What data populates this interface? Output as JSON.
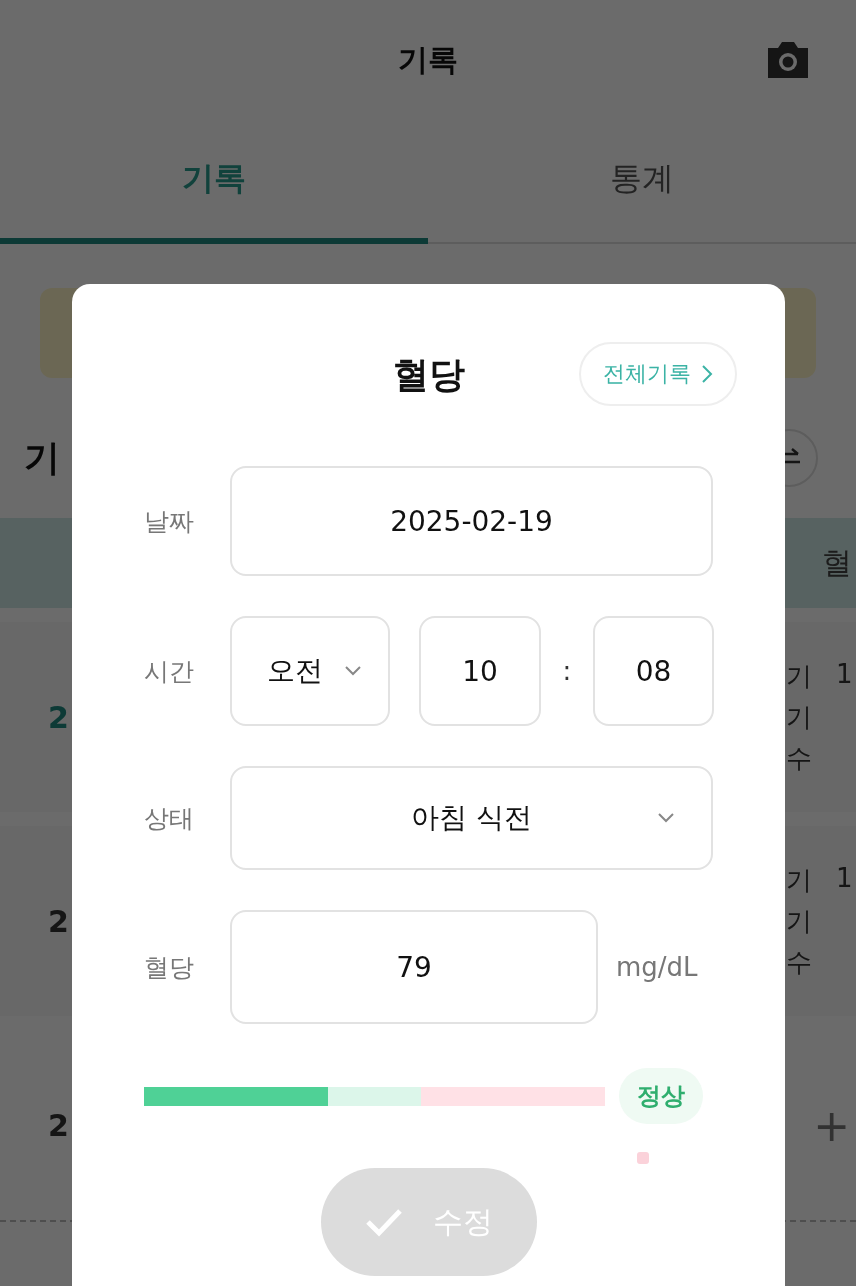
{
  "header": {
    "title": "기록"
  },
  "tabs": [
    {
      "label": "기록",
      "selected": true
    },
    {
      "label": "통계",
      "selected": false
    }
  ],
  "background": {
    "heading": "기",
    "column_header": "혈",
    "rows": [
      {
        "date": "2",
        "highlighted": true,
        "lines": [
          {
            "label": "기",
            "value": "1"
          },
          {
            "label": "기"
          },
          {
            "label": "수"
          }
        ]
      },
      {
        "date": "2",
        "highlighted": false,
        "lines": [
          {
            "label": "기",
            "value": "1"
          },
          {
            "label": "기"
          },
          {
            "label": "수"
          }
        ]
      },
      {
        "date": "2",
        "highlighted": false,
        "kind": "add",
        "add_label": "+"
      }
    ]
  },
  "dialog": {
    "title": "혈당",
    "history_button": "전체기록",
    "date": {
      "label": "날짜",
      "value": "2025-02-19"
    },
    "time": {
      "label": "시간",
      "period": "오전",
      "hour": "10",
      "separator": ":",
      "minute": "08"
    },
    "state": {
      "label": "상태",
      "value": "아침 식전"
    },
    "glucose": {
      "label": "혈당",
      "value": "79",
      "unit": "mg/dL"
    },
    "gauge": {
      "level": 0.4,
      "status": "정상"
    },
    "submit": {
      "label": "수정",
      "disabled": true
    }
  }
}
